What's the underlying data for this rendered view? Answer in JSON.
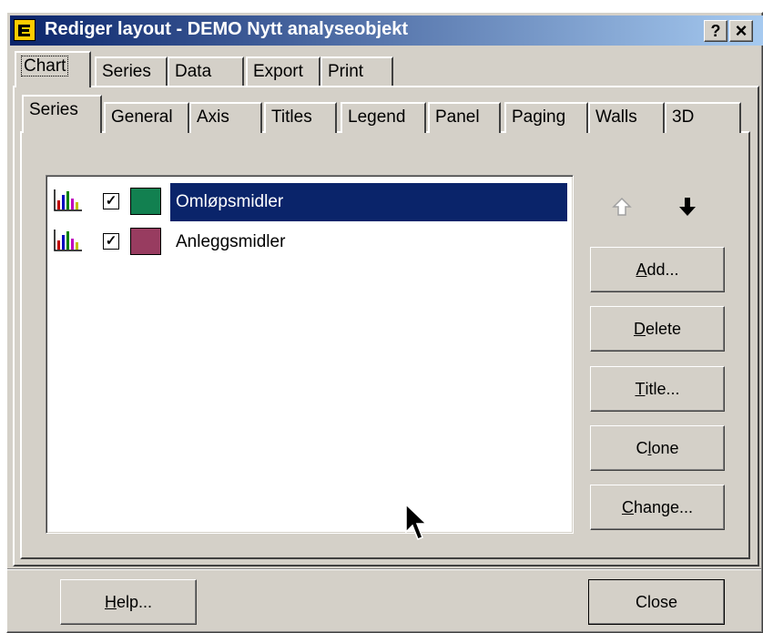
{
  "window": {
    "title": "Rediger layout - DEMO Nytt analyseobjekt",
    "help_btn": "?",
    "close_btn": "×"
  },
  "top_tabs": [
    "Chart",
    "Series",
    "Data",
    "Export",
    "Print"
  ],
  "sub_tabs": [
    "Series",
    "General",
    "Axis",
    "Titles",
    "Legend",
    "Panel",
    "Paging",
    "Walls",
    "3D"
  ],
  "series_list": [
    {
      "name": "Omløpsmidler",
      "color": "#128050",
      "checked": true,
      "selected": true
    },
    {
      "name": "Anleggsmidler",
      "color": "#983c60",
      "checked": true,
      "selected": false
    }
  ],
  "side_buttons": {
    "add": {
      "accel": "A",
      "rest": "dd..."
    },
    "delete": {
      "accel": "D",
      "rest": "elete"
    },
    "title": {
      "accel": "T",
      "rest": "itle..."
    },
    "clone": {
      "pre": "C",
      "accel": "l",
      "rest": "one"
    },
    "change": {
      "accel": "C",
      "rest": "hange..."
    }
  },
  "footer": {
    "help": {
      "accel": "H",
      "rest": "elp..."
    },
    "close": "Close"
  },
  "colors": {
    "titlebar_start": "#0a246a",
    "titlebar_end": "#a6caf0",
    "face": "#d4d0c8",
    "selection": "#0a246a"
  }
}
